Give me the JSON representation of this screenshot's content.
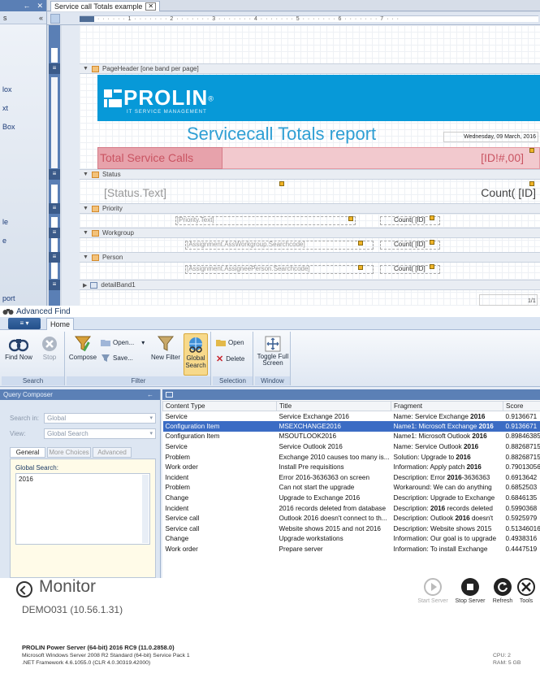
{
  "designer": {
    "panel_pin": "←",
    "panel_close": "✕",
    "panel_section": "s",
    "panel_collapse": "«",
    "side_labels": [
      "lox",
      "xt",
      "Box",
      "le",
      "e",
      "port"
    ],
    "tab_label": "Service call Totals example",
    "tab_close": "✕",
    "ruler_text": "· · · · · · 1 · · · · · · · 2 · · · · · · · 3 · · · · · · · 4 · · · · · · · 5 · · · · · · · 6 · · · · · · · 7 · · ·",
    "bands": {
      "page_header": "PageHeader [one band per page]",
      "status": "Status",
      "priority": "Priority",
      "workgroup": "Workgroup",
      "person": "Person",
      "detail": "detailBand1"
    },
    "logo_word": "PROLIN",
    "logo_reg": "®",
    "logo_sub": "IT SERVICE MANAGEMENT",
    "report_title": "Servicecall Totals report",
    "report_date": "Wednesday, 09 March, 2016",
    "total_label": "Total Service Calls",
    "total_value": "[ID!#,00]",
    "status_field": "[Status.Text]",
    "status_count": "Count( [ID]",
    "priority_field": "[Priority.Text]",
    "workgroup_field": "[Assignment.AssWorkgroup.Searchcode]",
    "person_field": "[Assignment.AssigneePerson.Searchcode]",
    "count_field": "Count( [ID]",
    "page_num": "1/1"
  },
  "advanced_find": {
    "title": "Advanced Find",
    "app_button": "≡ ▾",
    "home_tab": "Home",
    "ribbon": {
      "find_now": "Find Now",
      "stop": "Stop",
      "search_group": "Search",
      "compose": "Compose",
      "open": "Open...",
      "save": "Save...",
      "new_filter": "New Filter",
      "global_search": "Global Search",
      "filter_group": "Filter",
      "sel_open": "Open",
      "sel_delete": "Delete",
      "selection_group": "Selection",
      "toggle_full_screen": "Toggle Full Screen",
      "window_group": "Window"
    },
    "query_composer": {
      "title": "Query Composer",
      "pin": "←",
      "search_in_label": "Search in:",
      "search_in_value": "Global",
      "view_label": "View:",
      "view_value": "Global Search",
      "tabs": [
        "General",
        "More Choices",
        "Advanced"
      ],
      "global_search_label": "Global Search:",
      "global_search_value": "2016"
    },
    "results": {
      "headers": [
        "Content Type",
        "Title",
        "Fragment",
        "Score"
      ],
      "rows": [
        {
          "type": "Service",
          "title": "Service Exchange 2016",
          "frag_pre": "Name: Service Exchange ",
          "frag_bold": "2016",
          "frag_post": "",
          "score": "0.9136671"
        },
        {
          "type": "Configuration Item",
          "title": "MSEXCHANGE2016",
          "frag_pre": "Name1: Microsoft Exchange ",
          "frag_bold": "2016",
          "frag_post": "",
          "score": "0.9136671"
        },
        {
          "type": "Configuration Item",
          "title": "MSOUTLOOK2016",
          "frag_pre": "Name1: Microsoft Outlook ",
          "frag_bold": "2016",
          "frag_post": "",
          "score": "0.89846385"
        },
        {
          "type": "Service",
          "title": "Service Outlook 2016",
          "frag_pre": "Name: Service Outlook ",
          "frag_bold": "2016",
          "frag_post": "",
          "score": "0.88268715"
        },
        {
          "type": "Problem",
          "title": "Exchange 2010 causes too many is...",
          "frag_pre": "Solution: Upgrade to ",
          "frag_bold": "2016",
          "frag_post": "",
          "score": "0.88268715"
        },
        {
          "type": "Work order",
          "title": "Install Pre requisitions",
          "frag_pre": "Information: Apply patch ",
          "frag_bold": "2016",
          "frag_post": "",
          "score": "0.79013056"
        },
        {
          "type": "Incident",
          "title": "Error 2016-3636363 on screen",
          "frag_pre": "Description: Error ",
          "frag_bold": "2016",
          "frag_post": "-3636363",
          "score": "0.6913642"
        },
        {
          "type": "Problem",
          "title": "Can not start the upgrade",
          "frag_pre": "Workaround: We can do anything",
          "frag_bold": "",
          "frag_post": "",
          "score": "0.6852503"
        },
        {
          "type": "Change",
          "title": "Upgrade to Exchange 2016",
          "frag_pre": "Description: Upgrade to Exchange",
          "frag_bold": "",
          "frag_post": "",
          "score": "0.6846135"
        },
        {
          "type": "Incident",
          "title": "2016 records deleted from database",
          "frag_pre": "Description: ",
          "frag_bold": "2016",
          "frag_post": " records deleted",
          "score": "0.5990368"
        },
        {
          "type": "Service call",
          "title": "Outlook 2016 doesn't connect to th...",
          "frag_pre": "Description: Outlook ",
          "frag_bold": "2016",
          "frag_post": " doesn't",
          "score": "0.5925979"
        },
        {
          "type": "Service call",
          "title": "Website shows 2015 and not 2016",
          "frag_pre": "Description: Website shows 2015",
          "frag_bold": "",
          "frag_post": "",
          "score": "0.51346016"
        },
        {
          "type": "Change",
          "title": "Upgrade workstations",
          "frag_pre": "Information: Our goal is to upgrade",
          "frag_bold": "",
          "frag_post": "",
          "score": "0.4938316"
        },
        {
          "type": "Work order",
          "title": "Prepare server",
          "frag_pre": "Information: To install Exchange",
          "frag_bold": "",
          "frag_post": "",
          "score": "0.4447519"
        }
      ],
      "selected_index": 1
    }
  },
  "monitor": {
    "title": "Monitor",
    "host": "DEMO031 (10.56.1.31)",
    "tools": [
      "Start Server",
      "Stop Server",
      "Refresh",
      "Tools"
    ],
    "server": "PROLIN Power Server (64-bit) 2016 RC9 (11.0.2858.0)",
    "os": "Microsoft Windows Server 2008 R2 Standard (64-bit) Service Pack 1",
    "net": ".NET Framework 4.6.1055.0 (CLR 4.0.30319.42000)",
    "cpu": "CPU:  2",
    "ram": "RAM:  5 GB"
  },
  "colors": {
    "accent": "#0799d8",
    "selection": "#3b6cc4",
    "total_band": "#f2c9ce"
  }
}
